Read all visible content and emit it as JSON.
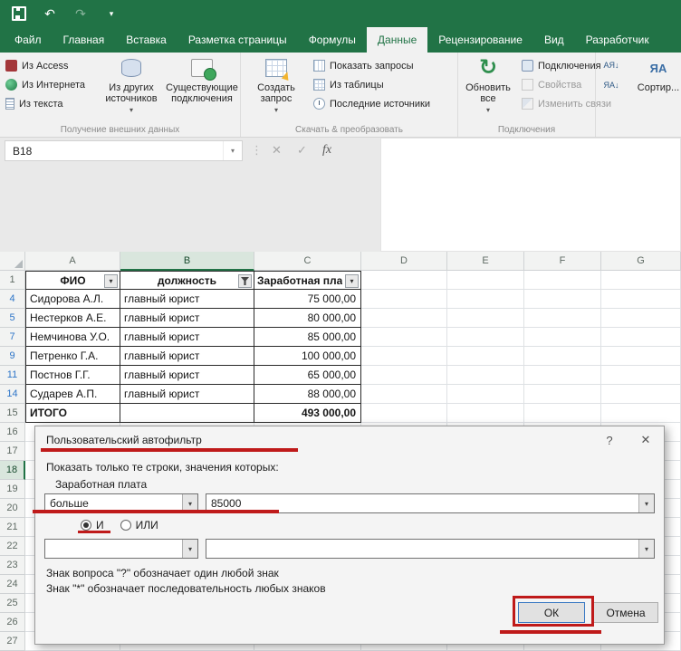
{
  "colors": {
    "excel_green": "#217346",
    "annotation_red": "#bf1a1a",
    "filtered_blue": "#2e75c8"
  },
  "icons": {
    "undo": "↶",
    "redo": "↷",
    "caret": "▾",
    "dropdown": "▾",
    "refresh": "↻",
    "cancel": "✕",
    "enter": "✓",
    "fx": "fx",
    "dots": "⋮",
    "help": "?",
    "close": "✕",
    "sort_asc": "АЯ↓",
    "sort_desc": "ЯА↓",
    "sort_big": "ЯА"
  },
  "tabs": {
    "items": [
      "Файл",
      "Главная",
      "Вставка",
      "Разметка страницы",
      "Формулы",
      "Данные",
      "Рецензирование",
      "Вид",
      "Разработчик"
    ],
    "active": "Данные"
  },
  "ribbon": {
    "group1": {
      "label": "Получение внешних данных",
      "item1": "Из Access",
      "item2": "Из Интернета",
      "item3": "Из текста",
      "big1": "Из других источников",
      "big2": "Существующие подключения"
    },
    "group2": {
      "label": "Скачать & преобразовать",
      "big1": "Создать запрос",
      "item1": "Показать запросы",
      "item2": "Из таблицы",
      "item3": "Последние источники"
    },
    "group3": {
      "label": "Подключения",
      "big1": "Обновить все",
      "item1": "Подключения",
      "item2": "Свойства",
      "item3": "Изменить связи"
    },
    "group4": {
      "big1": "Сортир..."
    }
  },
  "formula": {
    "name_box": "B18"
  },
  "sheet": {
    "col_headers": [
      "A",
      "B",
      "C",
      "D",
      "E",
      "F",
      "G"
    ],
    "selected_col": "B",
    "selected_row": "18",
    "table": {
      "header": {
        "a": "ФИО",
        "b": "должность",
        "c": "Заработная пла"
      },
      "rows": [
        {
          "n": "4",
          "a": "Сидорова А.Л.",
          "b": "главный юрист",
          "c": "75 000,00"
        },
        {
          "n": "5",
          "a": "Нестерков А.Е.",
          "b": "главный юрист",
          "c": "80 000,00"
        },
        {
          "n": "7",
          "a": "Немчинова У.О.",
          "b": "главный юрист",
          "c": "85 000,00"
        },
        {
          "n": "9",
          "a": "Петренко Г.А.",
          "b": "главный юрист",
          "c": "100 000,00"
        },
        {
          "n": "11",
          "a": "Постнов Г.Г.",
          "b": "главный юрист",
          "c": "65 000,00"
        },
        {
          "n": "14",
          "a": "Сударев А.П.",
          "b": "главный юрист",
          "c": "88 000,00"
        }
      ],
      "total": {
        "n": "15",
        "a": "ИТОГО",
        "c": "493 000,00"
      }
    },
    "empty_rows": [
      "16",
      "17",
      "18",
      "19",
      "20",
      "21",
      "22",
      "23",
      "24",
      "25",
      "26",
      "27"
    ]
  },
  "dialog": {
    "title": "Пользовательский автофильтр",
    "prompt": "Показать только те строки, значения которых:",
    "field_label": "Заработная плата",
    "operator1": "больше",
    "value1": "85000",
    "and_label": "И",
    "or_label": "ИЛИ",
    "operator2": "",
    "value2": "",
    "hint_question": "Знак вопроса \"?\" обозначает один любой знак",
    "hint_star": "Знак \"*\" обозначает последовательность любых знаков",
    "ok_label": "ОК",
    "cancel_label": "Отмена"
  }
}
